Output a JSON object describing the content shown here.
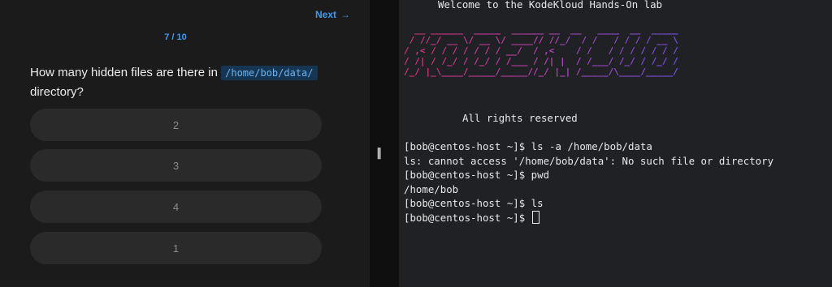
{
  "quiz": {
    "next_label": "Next",
    "next_icon": "arrow-right-icon",
    "progress": "7 / 10",
    "question_before": "How many hidden files are there in ",
    "question_path": "/home/bob/data/",
    "question_after": "directory?",
    "options": [
      "2",
      "3",
      "4",
      "1"
    ]
  },
  "divider": {
    "handle_icon": "drag-handle-icon",
    "handle_glyph": "||"
  },
  "terminal": {
    "welcome": "Welcome to the KodeKloud Hands-On lab",
    "banner_art": "  __ ______  _____  ______ __  __   ____  __  _____\n / //_/ __ \\/ __ \\/ ____// //_/  / /   / / / / __ \\\n/ ,< / / / / / / / __/  / ,<    / /   / / / / / / /\n/ /| / /_/ / /_/ / /___ / /| |  / /___/ /_/ / /_/ /\n/_/ |_\\____/_____/_____//_/ |_| /_____/\\____/_____/",
    "rights": "All rights reserved",
    "lines": [
      "[bob@centos-host ~]$ ls -a /home/bob/data",
      "ls: cannot access '/home/bob/data': No such file or directory",
      "[bob@centos-host ~]$ pwd",
      "/home/bob",
      "[bob@centos-host ~]$ ls",
      "[bob@centos-host ~]$ "
    ]
  }
}
